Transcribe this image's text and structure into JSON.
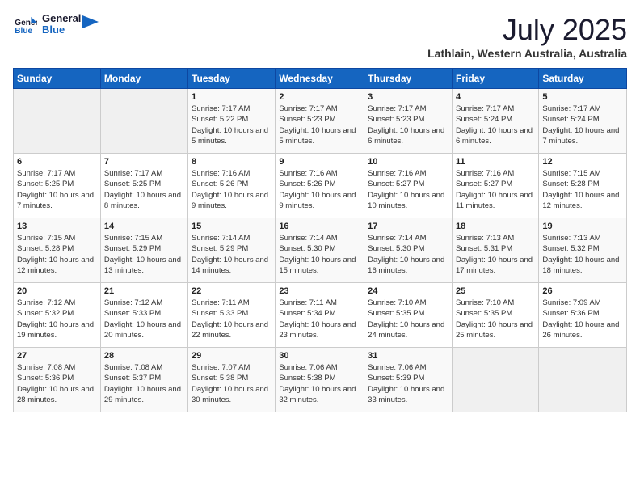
{
  "header": {
    "logo_line1": "General",
    "logo_line2": "Blue",
    "month": "July 2025",
    "location": "Lathlain, Western Australia, Australia"
  },
  "columns": [
    "Sunday",
    "Monday",
    "Tuesday",
    "Wednesday",
    "Thursday",
    "Friday",
    "Saturday"
  ],
  "weeks": [
    {
      "days": [
        {
          "num": "",
          "empty": true
        },
        {
          "num": "",
          "empty": true
        },
        {
          "num": "1",
          "sunrise": "7:17 AM",
          "sunset": "5:22 PM",
          "daylight": "10 hours and 5 minutes."
        },
        {
          "num": "2",
          "sunrise": "7:17 AM",
          "sunset": "5:23 PM",
          "daylight": "10 hours and 5 minutes."
        },
        {
          "num": "3",
          "sunrise": "7:17 AM",
          "sunset": "5:23 PM",
          "daylight": "10 hours and 6 minutes."
        },
        {
          "num": "4",
          "sunrise": "7:17 AM",
          "sunset": "5:24 PM",
          "daylight": "10 hours and 6 minutes."
        },
        {
          "num": "5",
          "sunrise": "7:17 AM",
          "sunset": "5:24 PM",
          "daylight": "10 hours and 7 minutes."
        }
      ]
    },
    {
      "days": [
        {
          "num": "6",
          "sunrise": "7:17 AM",
          "sunset": "5:25 PM",
          "daylight": "10 hours and 7 minutes."
        },
        {
          "num": "7",
          "sunrise": "7:17 AM",
          "sunset": "5:25 PM",
          "daylight": "10 hours and 8 minutes."
        },
        {
          "num": "8",
          "sunrise": "7:16 AM",
          "sunset": "5:26 PM",
          "daylight": "10 hours and 9 minutes."
        },
        {
          "num": "9",
          "sunrise": "7:16 AM",
          "sunset": "5:26 PM",
          "daylight": "10 hours and 9 minutes."
        },
        {
          "num": "10",
          "sunrise": "7:16 AM",
          "sunset": "5:27 PM",
          "daylight": "10 hours and 10 minutes."
        },
        {
          "num": "11",
          "sunrise": "7:16 AM",
          "sunset": "5:27 PM",
          "daylight": "10 hours and 11 minutes."
        },
        {
          "num": "12",
          "sunrise": "7:15 AM",
          "sunset": "5:28 PM",
          "daylight": "10 hours and 12 minutes."
        }
      ]
    },
    {
      "days": [
        {
          "num": "13",
          "sunrise": "7:15 AM",
          "sunset": "5:28 PM",
          "daylight": "10 hours and 12 minutes."
        },
        {
          "num": "14",
          "sunrise": "7:15 AM",
          "sunset": "5:29 PM",
          "daylight": "10 hours and 13 minutes."
        },
        {
          "num": "15",
          "sunrise": "7:14 AM",
          "sunset": "5:29 PM",
          "daylight": "10 hours and 14 minutes."
        },
        {
          "num": "16",
          "sunrise": "7:14 AM",
          "sunset": "5:30 PM",
          "daylight": "10 hours and 15 minutes."
        },
        {
          "num": "17",
          "sunrise": "7:14 AM",
          "sunset": "5:30 PM",
          "daylight": "10 hours and 16 minutes."
        },
        {
          "num": "18",
          "sunrise": "7:13 AM",
          "sunset": "5:31 PM",
          "daylight": "10 hours and 17 minutes."
        },
        {
          "num": "19",
          "sunrise": "7:13 AM",
          "sunset": "5:32 PM",
          "daylight": "10 hours and 18 minutes."
        }
      ]
    },
    {
      "days": [
        {
          "num": "20",
          "sunrise": "7:12 AM",
          "sunset": "5:32 PM",
          "daylight": "10 hours and 19 minutes."
        },
        {
          "num": "21",
          "sunrise": "7:12 AM",
          "sunset": "5:33 PM",
          "daylight": "10 hours and 20 minutes."
        },
        {
          "num": "22",
          "sunrise": "7:11 AM",
          "sunset": "5:33 PM",
          "daylight": "10 hours and 22 minutes."
        },
        {
          "num": "23",
          "sunrise": "7:11 AM",
          "sunset": "5:34 PM",
          "daylight": "10 hours and 23 minutes."
        },
        {
          "num": "24",
          "sunrise": "7:10 AM",
          "sunset": "5:35 PM",
          "daylight": "10 hours and 24 minutes."
        },
        {
          "num": "25",
          "sunrise": "7:10 AM",
          "sunset": "5:35 PM",
          "daylight": "10 hours and 25 minutes."
        },
        {
          "num": "26",
          "sunrise": "7:09 AM",
          "sunset": "5:36 PM",
          "daylight": "10 hours and 26 minutes."
        }
      ]
    },
    {
      "days": [
        {
          "num": "27",
          "sunrise": "7:08 AM",
          "sunset": "5:36 PM",
          "daylight": "10 hours and 28 minutes."
        },
        {
          "num": "28",
          "sunrise": "7:08 AM",
          "sunset": "5:37 PM",
          "daylight": "10 hours and 29 minutes."
        },
        {
          "num": "29",
          "sunrise": "7:07 AM",
          "sunset": "5:38 PM",
          "daylight": "10 hours and 30 minutes."
        },
        {
          "num": "30",
          "sunrise": "7:06 AM",
          "sunset": "5:38 PM",
          "daylight": "10 hours and 32 minutes."
        },
        {
          "num": "31",
          "sunrise": "7:06 AM",
          "sunset": "5:39 PM",
          "daylight": "10 hours and 33 minutes."
        },
        {
          "num": "",
          "empty": true
        },
        {
          "num": "",
          "empty": true
        }
      ]
    }
  ],
  "labels": {
    "sunrise_prefix": "Sunrise: ",
    "sunset_prefix": "Sunset: ",
    "daylight_prefix": "Daylight: "
  }
}
